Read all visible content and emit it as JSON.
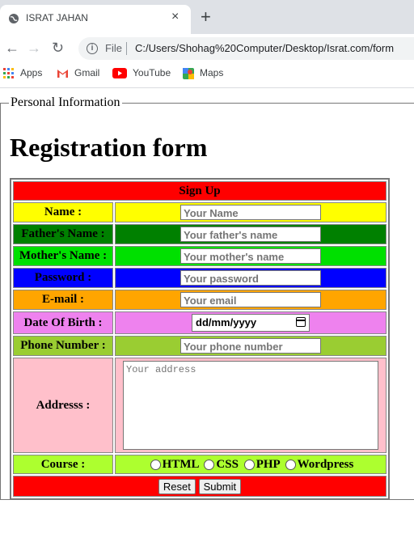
{
  "browser": {
    "tab_title": "ISRAT JAHAN",
    "tab_close": "×",
    "new_tab": "+",
    "back": "←",
    "forward": "→",
    "reload": "↻",
    "info": "i",
    "file_label": "File",
    "url": "C:/Users/Shohag%20Computer/Desktop/Israt.com/form",
    "bookmarks": [
      {
        "label": "Apps",
        "icon": "apps-grid-icon"
      },
      {
        "label": "Gmail",
        "icon": "gmail-icon"
      },
      {
        "label": "YouTube",
        "icon": "youtube-icon"
      },
      {
        "label": "Maps",
        "icon": "maps-icon"
      }
    ]
  },
  "page": {
    "legend": "Personal Information",
    "heading": "Registration form",
    "header_row": "Sign Up",
    "fields": {
      "name": {
        "label": "Name :",
        "placeholder": "Your Name",
        "color": "#ffff00"
      },
      "father": {
        "label": "Father's Name :",
        "placeholder": "Your father's name",
        "color": "#008000"
      },
      "mother": {
        "label": "Mother's Name :",
        "placeholder": "Your mother's name",
        "color": "#00e000"
      },
      "password": {
        "label": "Password :",
        "placeholder": "Your password",
        "color": "#0000ff"
      },
      "email": {
        "label": "E-mail :",
        "placeholder": "Your email",
        "color": "#ffa500"
      },
      "dob": {
        "label": "Date Of Birth :",
        "placeholder": "dd/mm/yyyy",
        "color": "#ee82ee"
      },
      "phone": {
        "label": "Phone Number :",
        "placeholder": "Your phone number",
        "color": "#9acd32"
      },
      "address": {
        "label": "Addresss :",
        "placeholder": "Your address",
        "color": "#ffc0cb"
      },
      "course": {
        "label": "Course :",
        "options": [
          "HTML",
          "CSS",
          "PHP",
          "Wordpress"
        ],
        "color": "#adff2f"
      }
    },
    "buttons": {
      "reset": "Reset",
      "submit": "Submit"
    },
    "colors": {
      "header": "#ff0000",
      "footer": "#ff0000"
    }
  }
}
